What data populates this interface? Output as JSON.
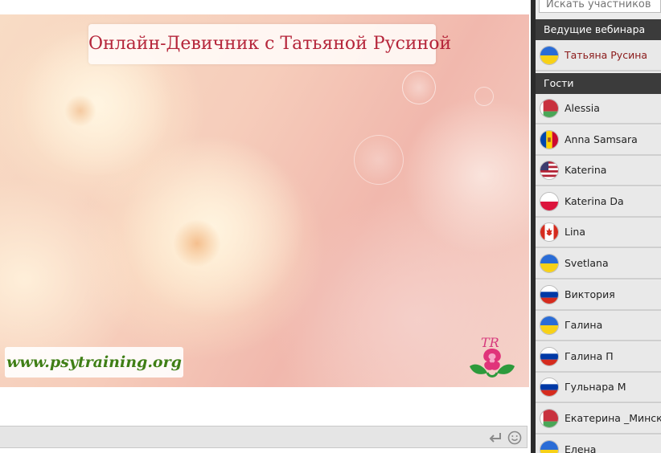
{
  "banner": {
    "title": "Онлайн-Девичник с Татьяной Русиной",
    "website": "www.psytraining.org"
  },
  "chat": {
    "input_value": "",
    "placeholder": ""
  },
  "panel": {
    "search_placeholder": "Искать участников",
    "hosts_header": "Ведущие вебинара",
    "guests_header": "Гости",
    "hosts": [
      {
        "name": "Татьяна Русина",
        "flag": "ua"
      }
    ],
    "guests": [
      {
        "name": "Alessia",
        "flag": "by"
      },
      {
        "name": "Anna Samsara",
        "flag": "md"
      },
      {
        "name": "Katerina",
        "flag": "us"
      },
      {
        "name": "Katerina Da",
        "flag": "pl"
      },
      {
        "name": "Lina",
        "flag": "ca"
      },
      {
        "name": "Svetlana",
        "flag": "ua"
      },
      {
        "name": "Виктория",
        "flag": "ru"
      },
      {
        "name": "Галина",
        "flag": "ua"
      },
      {
        "name": "Галина П",
        "flag": "ru"
      },
      {
        "name": "Гульнара М",
        "flag": "ru"
      },
      {
        "name": "Екатерина _Минск",
        "flag": "by"
      },
      {
        "name": "Елена",
        "flag": "ua"
      }
    ]
  },
  "colors": {
    "title_text": "#b5253a",
    "website_text": "#3f7f16",
    "section_header_bg": "#3b3b3b",
    "host_name": "#8b1a1a"
  },
  "icons": {
    "enter": "enter-icon",
    "emoji": "smile-icon",
    "logo": "tr-rose-logo"
  }
}
